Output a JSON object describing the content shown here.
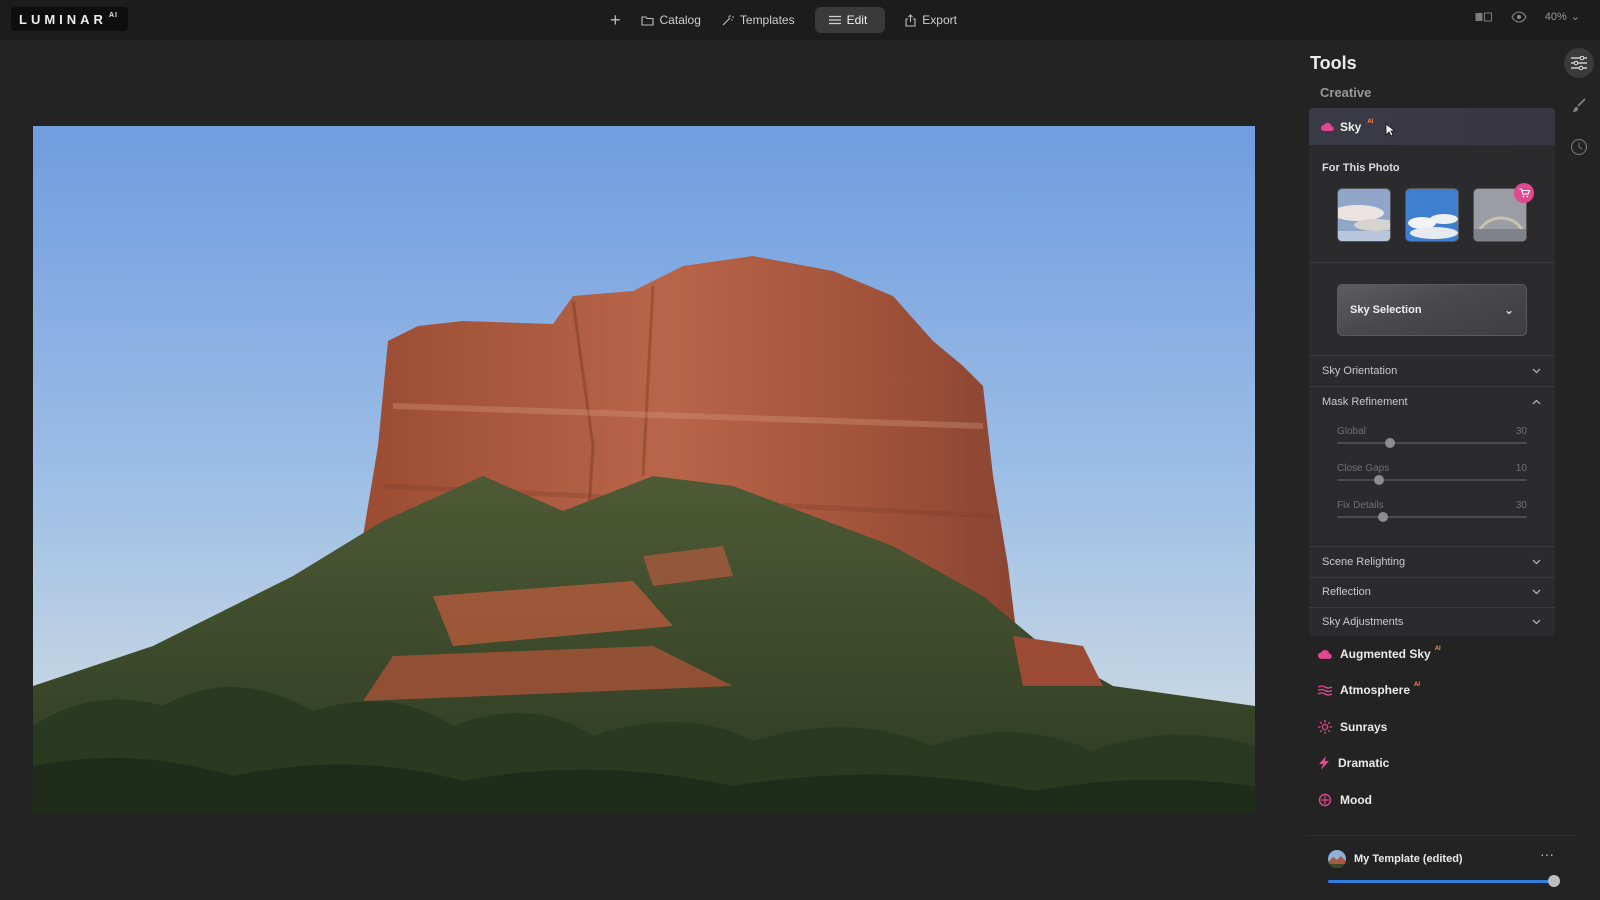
{
  "app": {
    "logo": "LUMINAR",
    "logo_sup": "AI"
  },
  "topnav": {
    "add_icon": "plus-icon",
    "catalog": "Catalog",
    "templates": "Templates",
    "edit": "Edit",
    "export": "Export"
  },
  "topright": {
    "zoom": "40%"
  },
  "panel": {
    "title": "Tools",
    "group": "Creative",
    "sky": {
      "label": "Sky",
      "ai_badge": "AI",
      "for_this_photo": "For This Photo",
      "selection": "Sky Selection",
      "sections": [
        {
          "label": "Sky Orientation",
          "state": "collapsed"
        },
        {
          "label": "Mask Refinement",
          "state": "expanded"
        },
        {
          "label": "Scene Relighting",
          "state": "collapsed"
        },
        {
          "label": "Reflection",
          "state": "collapsed"
        },
        {
          "label": "Sky Adjustments",
          "state": "collapsed"
        }
      ],
      "sliders": [
        {
          "label": "Global",
          "value": "30",
          "level": 0.28
        },
        {
          "label": "Close Gaps",
          "value": "10",
          "level": 0.22
        },
        {
          "label": "Fix Details",
          "value": "30",
          "level": 0.24
        }
      ]
    },
    "tools": [
      {
        "label": "Augmented Sky",
        "ai": "AI",
        "icon": "cloud-icon",
        "color": "#e0488f"
      },
      {
        "label": "Atmosphere",
        "ai": "AI",
        "icon": "waves-icon",
        "color": "#e0488f"
      },
      {
        "label": "Sunrays",
        "ai": "",
        "icon": "sun-icon",
        "color": "#e0488f"
      },
      {
        "label": "Dramatic",
        "ai": "",
        "icon": "bolt-icon",
        "color": "#e0488f"
      },
      {
        "label": "Mood",
        "ai": "",
        "icon": "flower-icon",
        "color": "#e0488f"
      }
    ],
    "template": {
      "name": "My Template (edited)",
      "more": "···",
      "amount": 1.0
    }
  },
  "colors": {
    "accent": "#e0488f",
    "slider_blue": "#2f7fe0"
  }
}
